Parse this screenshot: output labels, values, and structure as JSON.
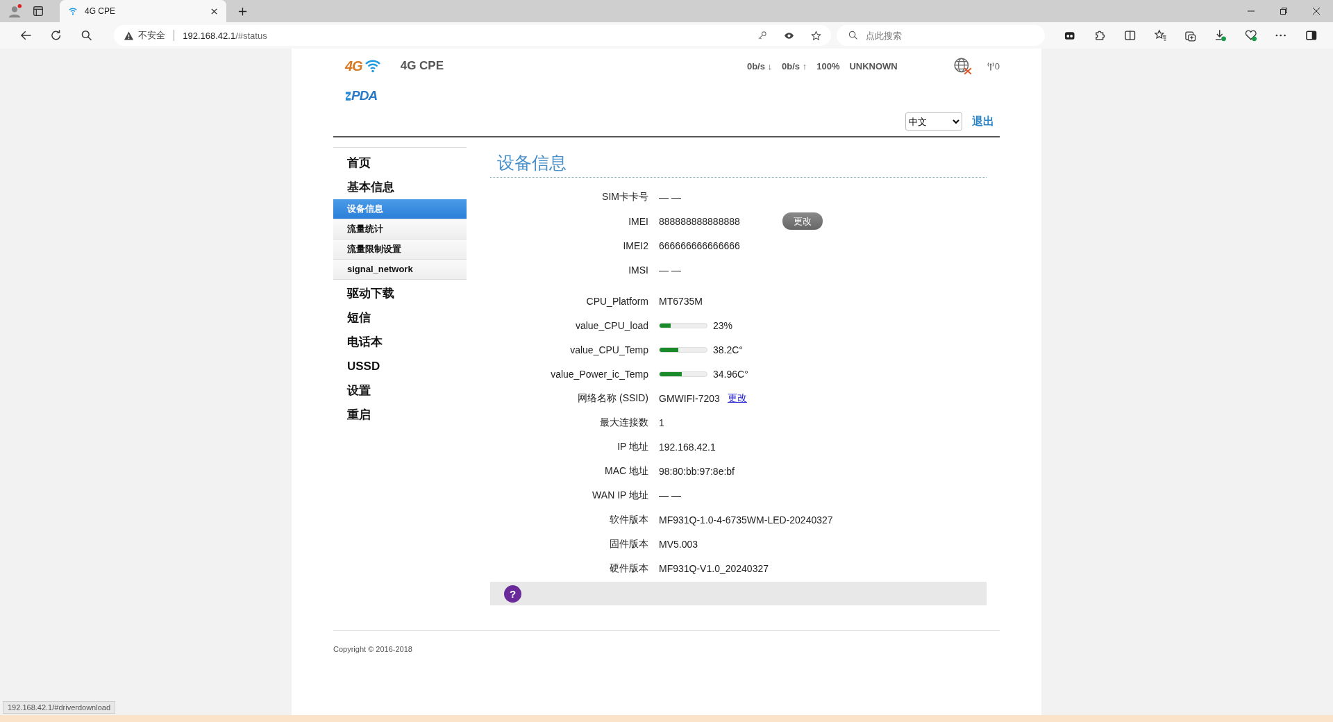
{
  "browser": {
    "tab_title": "4G CPE",
    "security": "不安全",
    "address_host": "192.168.42.1",
    "address_path": "/#status",
    "search": {
      "placeholder": "点此搜索"
    },
    "status_url": "192.168.42.1/#driverdownload"
  },
  "header": {
    "logo_badge": "4G",
    "product": "4G CPE",
    "brand": "PDA",
    "down_rate": "0b/s ↓",
    "up_rate": "0b/s ↑",
    "battery": "100%",
    "network": "UNKNOWN",
    "signal_count": "0",
    "language": "中文",
    "logout": "退出"
  },
  "sidebar": {
    "items": [
      {
        "label": "首页",
        "selected": false
      },
      {
        "label": "基本信息",
        "selected": false,
        "children": [
          {
            "label": "设备信息",
            "selected": true
          },
          {
            "label": "流量统计",
            "selected": false
          },
          {
            "label": "流量限制设置",
            "selected": false
          },
          {
            "label": "signal_network",
            "selected": false
          }
        ]
      },
      {
        "label": "驱动下载",
        "selected": false
      },
      {
        "label": "短信",
        "selected": false
      },
      {
        "label": "电话本",
        "selected": false
      },
      {
        "label": "USSD",
        "selected": false
      },
      {
        "label": "设置",
        "selected": false
      },
      {
        "label": "重启",
        "selected": false
      }
    ]
  },
  "page_title": "设备信息",
  "groups": [
    [
      {
        "kind": "text",
        "label": "SIM卡卡号",
        "value": "— —"
      },
      {
        "kind": "button",
        "label": "IMEI",
        "value": "888888888888888",
        "action": "更改"
      },
      {
        "kind": "text",
        "label": "IMEI2",
        "value": "666666666666666"
      },
      {
        "kind": "text",
        "label": "IMSI",
        "value": "— —"
      }
    ],
    [
      {
        "kind": "text",
        "label": "CPU_Platform",
        "value": "MT6735M"
      },
      {
        "kind": "bar",
        "label": "value_CPU_load",
        "level": 0.23,
        "value": "23%"
      },
      {
        "kind": "bar",
        "label": "value_CPU_Temp",
        "level": 0.4,
        "value": "38.2C°"
      },
      {
        "kind": "bar",
        "label": "value_Power_ic_Temp",
        "level": 0.47,
        "value": "34.96C°"
      },
      {
        "kind": "link",
        "label": "网络名称 (SSID)",
        "value": "GMWIFI-7203",
        "action": "更改"
      },
      {
        "kind": "text",
        "label": "最大连接数",
        "value": "1"
      },
      {
        "kind": "text",
        "label": "IP 地址",
        "value": "192.168.42.1"
      },
      {
        "kind": "text",
        "label": "MAC 地址",
        "value": "98:80:bb:97:8e:bf"
      },
      {
        "kind": "text",
        "label": "WAN IP 地址",
        "value": "— —"
      },
      {
        "kind": "text",
        "label": "软件版本",
        "value": "MF931Q-1.0-4-6735WM-LED-20240327"
      },
      {
        "kind": "text",
        "label": "固件版本",
        "value": "MV5.003"
      },
      {
        "kind": "text",
        "label": "硬件版本",
        "value": "MF931Q-V1.0_20240327"
      }
    ]
  ],
  "help": "?",
  "copyright": "Copyright © 2016-2018"
}
